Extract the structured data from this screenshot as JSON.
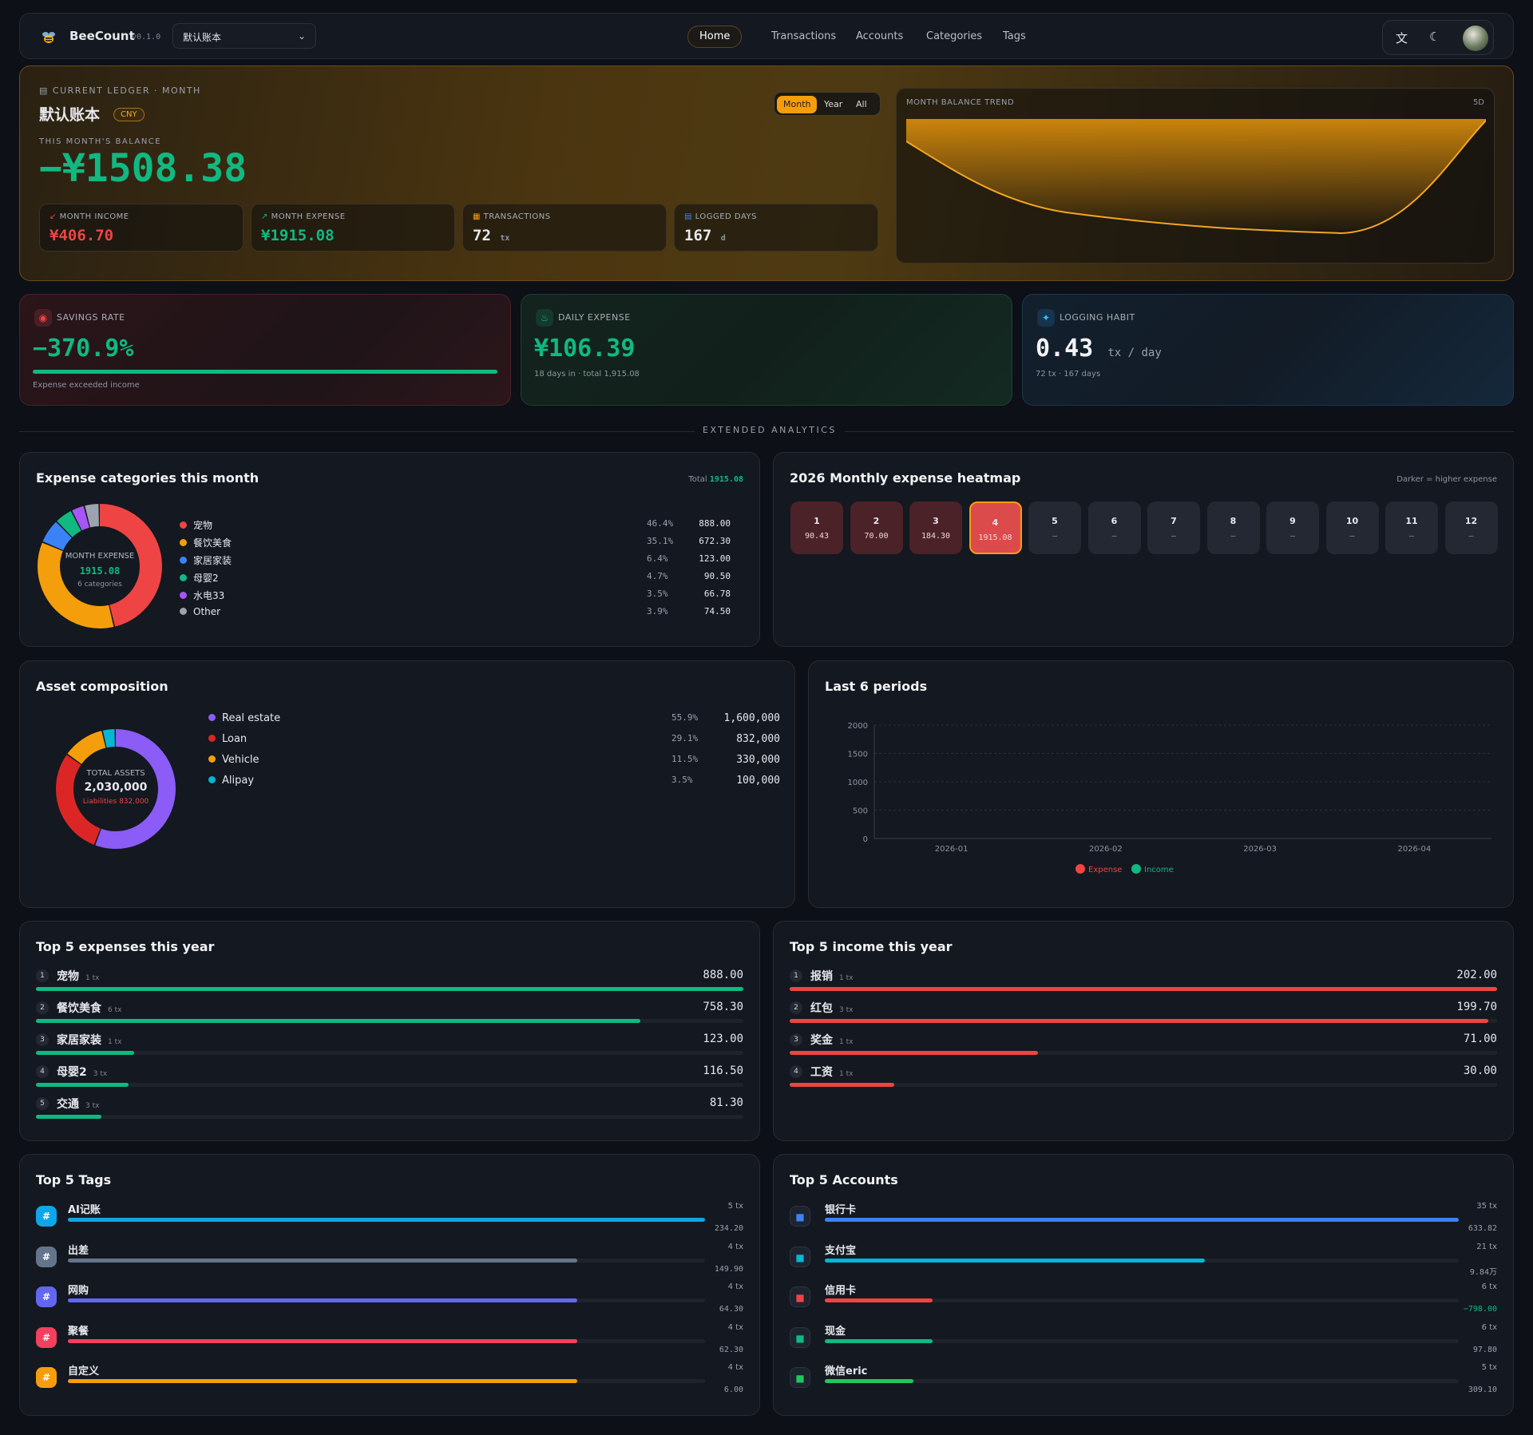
{
  "nav": {
    "brand": "BeeCount",
    "version": "v0.1.0",
    "ledger": "默认账本",
    "links": [
      "Home",
      "Transactions",
      "Accounts",
      "Categories",
      "Tags"
    ]
  },
  "hero": {
    "kicker": "CURRENT LEDGER · MONTH",
    "ledger_name": "默认账本",
    "currency": "CNY",
    "balance_label": "THIS MONTH'S BALANCE",
    "balance": "−¥1508.38",
    "period": [
      "Month",
      "Year",
      "All"
    ],
    "mini": [
      {
        "label": "MONTH INCOME",
        "value": "¥406.70",
        "unit": ""
      },
      {
        "label": "MONTH EXPENSE",
        "value": "¥1915.08",
        "unit": ""
      },
      {
        "label": "TRANSACTIONS",
        "value": "72",
        "unit": "tx"
      },
      {
        "label": "LOGGED DAYS",
        "value": "167",
        "unit": "d"
      }
    ],
    "trend_label": "MONTH BALANCE TREND",
    "trend_badge": "5D"
  },
  "stats": [
    {
      "label": "SAVINGS RATE",
      "value": "−370.9%",
      "sub": "Expense exceeded income",
      "fill": 1.0
    },
    {
      "label": "DAILY EXPENSE",
      "value": "¥106.39",
      "sub": "18 days in · total 1,915.08"
    },
    {
      "label": "LOGGING HABIT",
      "value": "0.43",
      "unit": "tx / day",
      "sub": "72 tx · 167 days"
    }
  ],
  "divider": "EXTENDED ANALYTICS",
  "expcat": {
    "title": "Expense categories this month",
    "total_label": "Total",
    "total": "1915.08",
    "center_label": "MONTH EXPENSE",
    "center_value": "1915.08",
    "center_sub": "6 categories",
    "items": [
      {
        "name": "宠物",
        "pct": "46.4%",
        "amt": "888.00",
        "color": "#ef4444",
        "v": 46.4
      },
      {
        "name": "餐饮美食",
        "pct": "35.1%",
        "amt": "672.30",
        "color": "#f59e0b",
        "v": 35.1
      },
      {
        "name": "家居家装",
        "pct": "6.4%",
        "amt": "123.00",
        "color": "#3b82f6",
        "v": 6.4
      },
      {
        "name": "母婴2",
        "pct": "4.7%",
        "amt": "90.50",
        "color": "#10b981",
        "v": 4.7
      },
      {
        "name": "水电33",
        "pct": "3.5%",
        "amt": "66.78",
        "color": "#a855f7",
        "v": 3.5
      },
      {
        "name": "Other",
        "pct": "3.9%",
        "amt": "74.50",
        "color": "#9ca3af",
        "v": 3.9
      }
    ]
  },
  "heatmap": {
    "title": "2026 Monthly expense heatmap",
    "hint": "Darker = higher expense",
    "months": [
      {
        "m": "1",
        "v": "90.43"
      },
      {
        "m": "2",
        "v": "70.00"
      },
      {
        "m": "3",
        "v": "184.30"
      },
      {
        "m": "4",
        "v": "1915.08"
      },
      {
        "m": "5",
        "v": "–"
      },
      {
        "m": "6",
        "v": "–"
      },
      {
        "m": "7",
        "v": "–"
      },
      {
        "m": "8",
        "v": "–"
      },
      {
        "m": "9",
        "v": "–"
      },
      {
        "m": "10",
        "v": "–"
      },
      {
        "m": "11",
        "v": "–"
      },
      {
        "m": "12",
        "v": "–"
      }
    ]
  },
  "assets": {
    "title": "Asset composition",
    "center_label": "TOTAL ASSETS",
    "center_value": "2,030,000",
    "liab": "Liabilities 832,000",
    "items": [
      {
        "name": "Real estate",
        "pct": "55.9%",
        "amt": "1,600,000",
        "color": "#8b5cf6",
        "v": 55.9
      },
      {
        "name": "Loan",
        "pct": "29.1%",
        "amt": "832,000",
        "color": "#dc2626",
        "v": 29.1
      },
      {
        "name": "Vehicle",
        "pct": "11.5%",
        "amt": "330,000",
        "color": "#f59e0b",
        "v": 11.5
      },
      {
        "name": "Alipay",
        "pct": "3.5%",
        "amt": "100,000",
        "color": "#06b6d4",
        "v": 3.5
      }
    ]
  },
  "chart_data": {
    "type": "bar",
    "title": "Last 6 periods",
    "categories": [
      "2026-01",
      "2026-02",
      "2026-03",
      "2026-04"
    ],
    "ylim": [
      0,
      2000
    ],
    "yticks": [
      "2000",
      "1500",
      "1000",
      "500",
      "0"
    ],
    "series": [
      {
        "name": "Expense",
        "color": "#ef4444",
        "values": [
          0,
          0,
          0,
          0
        ]
      },
      {
        "name": "Income",
        "color": "#10b981",
        "values": [
          0,
          0,
          0,
          0
        ]
      }
    ]
  },
  "topexp": {
    "title": "Top 5 expenses this year",
    "items": [
      {
        "name": "宠物",
        "tx": "1 tx",
        "amt": "888.00",
        "f": 1.0
      },
      {
        "name": "餐饮美食",
        "tx": "6 tx",
        "amt": "758.30",
        "f": 0.854
      },
      {
        "name": "家居家装",
        "tx": "1 tx",
        "amt": "123.00",
        "f": 0.139
      },
      {
        "name": "母婴2",
        "tx": "3 tx",
        "amt": "116.50",
        "f": 0.131
      },
      {
        "name": "交通",
        "tx": "3 tx",
        "amt": "81.30",
        "f": 0.092
      }
    ]
  },
  "topinc": {
    "title": "Top 5 income this year",
    "items": [
      {
        "name": "报销",
        "tx": "1 tx",
        "amt": "202.00",
        "f": 1.0
      },
      {
        "name": "红包",
        "tx": "3 tx",
        "amt": "199.70",
        "f": 0.988
      },
      {
        "name": "奖金",
        "tx": "1 tx",
        "amt": "71.00",
        "f": 0.351
      },
      {
        "name": "工资",
        "tx": "1 tx",
        "amt": "30.00",
        "f": 0.148
      }
    ]
  },
  "toptags": {
    "title": "Top 5 Tags",
    "items": [
      {
        "name": "AI记账",
        "tx": "5 tx",
        "amt": "234.20",
        "color": "#0ea5e9",
        "f": 1.0
      },
      {
        "name": "出差",
        "tx": "4 tx",
        "amt": "149.90",
        "color": "#64748b",
        "f": 0.8
      },
      {
        "name": "网购",
        "tx": "4 tx",
        "amt": "64.30",
        "color": "#6366f1",
        "f": 0.8
      },
      {
        "name": "聚餐",
        "tx": "4 tx",
        "amt": "62.30",
        "color": "#f43f5e",
        "f": 0.8
      },
      {
        "name": "自定义",
        "tx": "4 tx",
        "amt": "6.00",
        "color": "#f59e0b",
        "f": 0.8
      }
    ]
  },
  "topacc": {
    "title": "Top 5 Accounts",
    "items": [
      {
        "name": "银行卡",
        "tx": "35 tx",
        "amt": "633.82",
        "color": "#3b82f6",
        "f": 1.0,
        "icon": "bank-card-icon",
        "neg": false
      },
      {
        "name": "支付宝",
        "tx": "21 tx",
        "amt": "9.84万",
        "color": "#06b6d4",
        "f": 0.6,
        "icon": "alipay-icon",
        "neg": false
      },
      {
        "name": "信用卡",
        "tx": "6 tx",
        "amt": "−798.00",
        "color": "#ef4444",
        "f": 0.17,
        "icon": "credit-card-icon",
        "neg": true
      },
      {
        "name": "现金",
        "tx": "6 tx",
        "amt": "97.80",
        "color": "#10b981",
        "f": 0.17,
        "icon": "cash-icon",
        "neg": false
      },
      {
        "name": "微信eric",
        "tx": "5 tx",
        "amt": "309.10",
        "color": "#22c55e",
        "f": 0.14,
        "icon": "wechat-icon",
        "neg": false
      }
    ]
  }
}
